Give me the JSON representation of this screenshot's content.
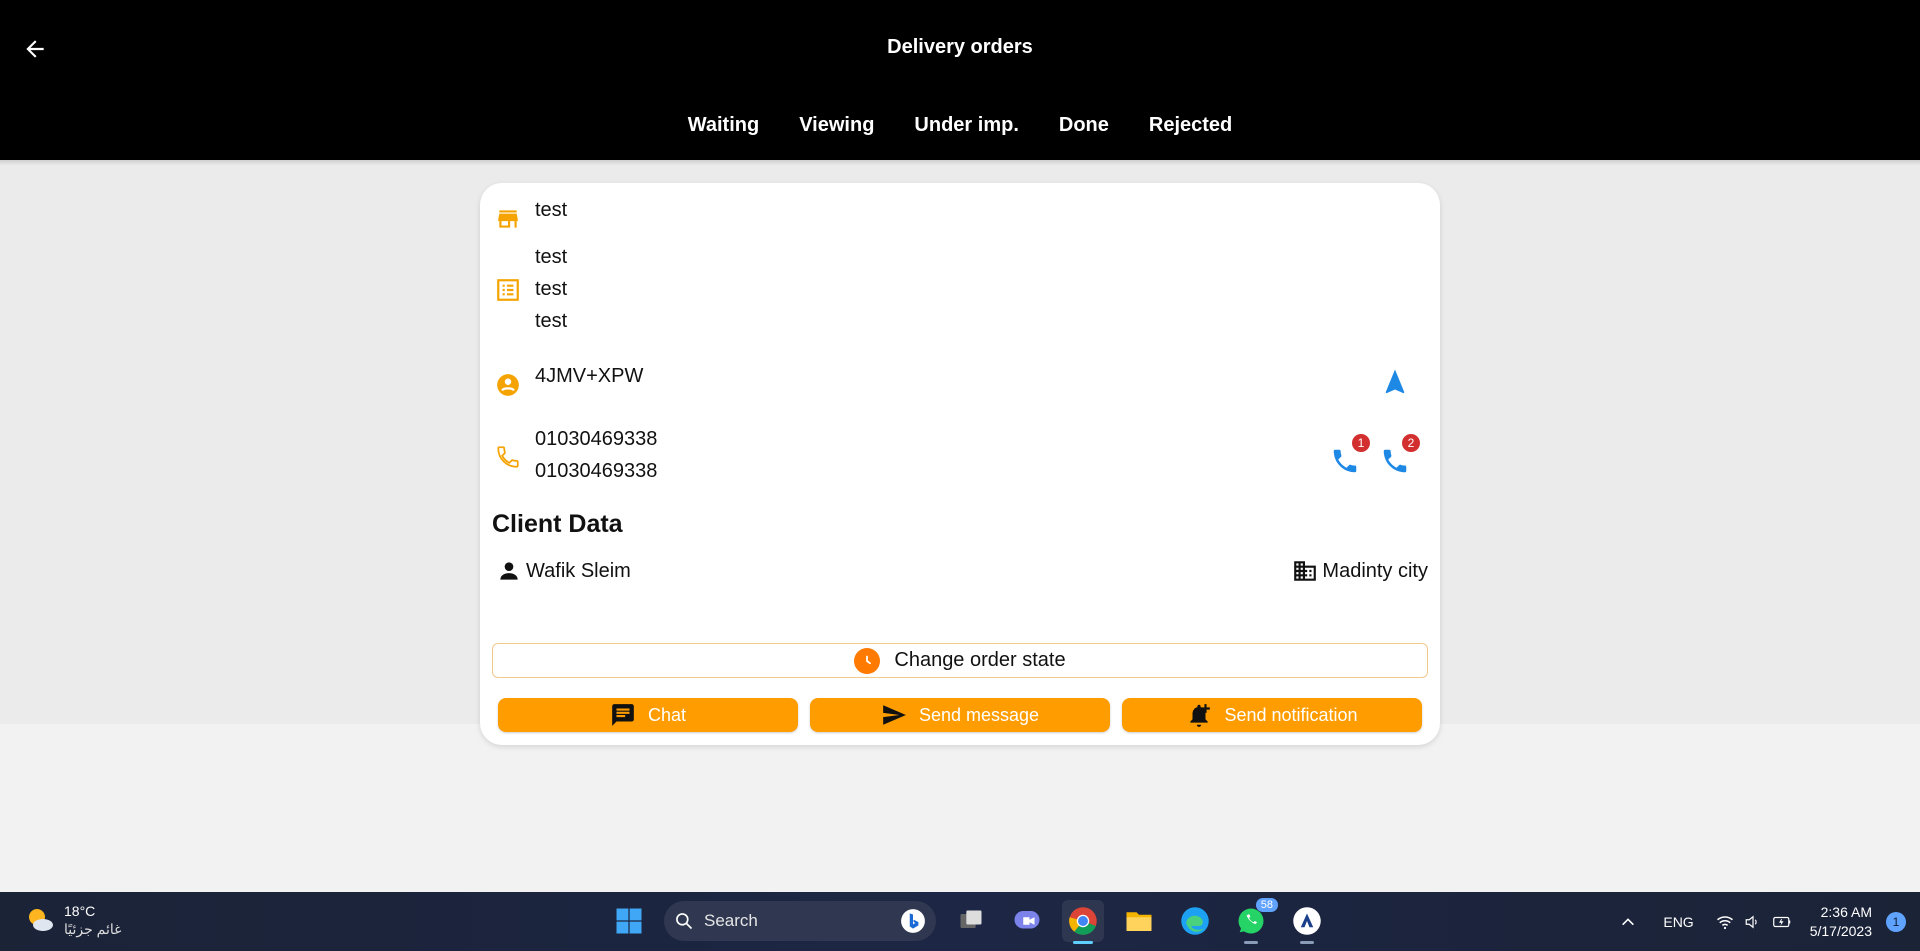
{
  "app": {
    "title": "Delivery orders",
    "tabs": [
      {
        "label": "Waiting",
        "active": true
      },
      {
        "label": "Viewing",
        "active": false
      },
      {
        "label": "Under imp.",
        "active": false
      },
      {
        "label": "Done",
        "active": false
      },
      {
        "label": "Rejected",
        "active": false
      }
    ]
  },
  "order": {
    "store": "test",
    "items": [
      "test",
      "test",
      "test"
    ],
    "location": "4JMV+XPW",
    "phones": [
      "01030469338",
      "01030469338"
    ],
    "call_badges": [
      "1",
      "2"
    ],
    "client_section_title": "Client Data",
    "client_name": "Wafik Sleim",
    "client_city": "Madinty city",
    "change_state_label": "Change order state",
    "actions": {
      "chat": "Chat",
      "send_message": "Send message",
      "send_notification": "Send notification"
    }
  },
  "colors": {
    "accent": "#ff9d00",
    "icon_orange": "#f5a300",
    "call_blue": "#1e88e5",
    "badge_red": "#d32f2f",
    "header_bg": "#000000"
  },
  "taskbar": {
    "weather_temp": "18°C",
    "weather_desc": "غائم جزئيًا",
    "search_placeholder": "Search",
    "whatsapp_badge": "58",
    "language": "ENG",
    "time": "2:36 AM",
    "date": "5/17/2023",
    "notification_count": "1",
    "pinned_icons": [
      "windows-start-icon",
      "task-view-icon",
      "teams-icon",
      "chrome-icon",
      "file-explorer-icon",
      "edge-icon",
      "whatsapp-icon",
      "app-icon"
    ]
  }
}
